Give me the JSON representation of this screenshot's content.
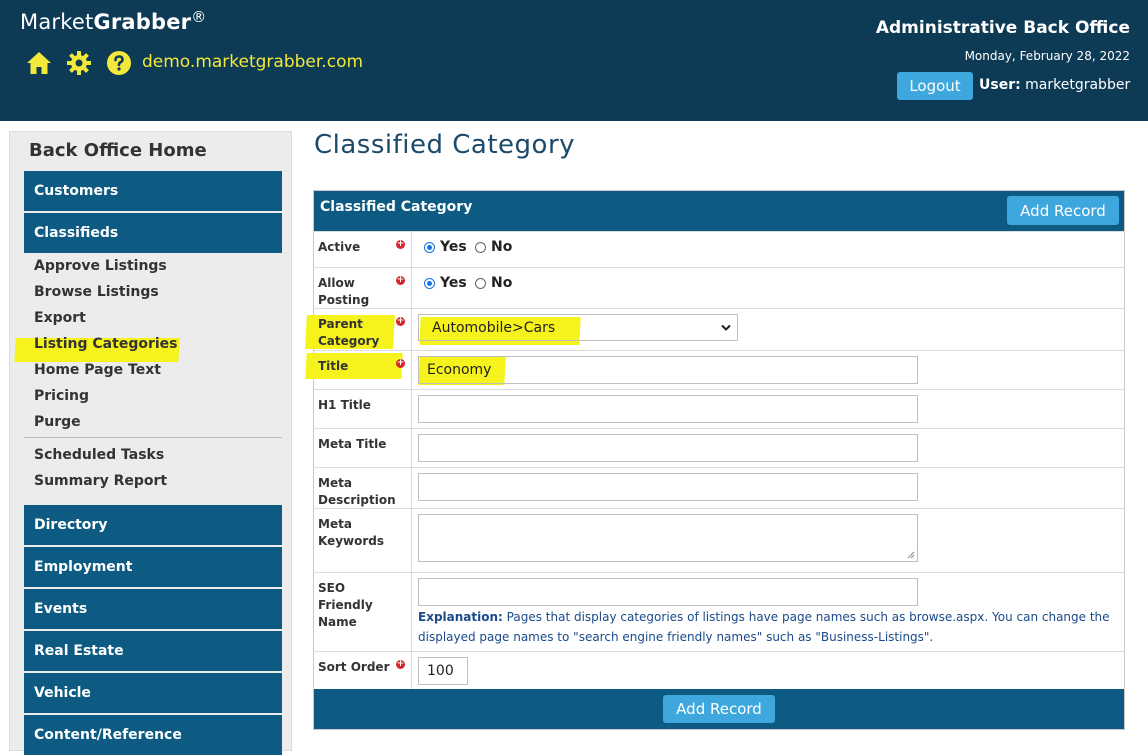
{
  "header": {
    "logo_part1": "Market",
    "logo_part2": "Grabber",
    "logo_reg": "®",
    "site": "demo.marketgrabber.com",
    "title": "Administrative Back Office",
    "date": "Monday, February 28, 2022",
    "logout_label": "Logout",
    "user_label": "User:",
    "user_name": "marketgrabber",
    "icons": [
      "home-icon",
      "gear-icon",
      "help-icon"
    ]
  },
  "sidebar": {
    "home": "Back Office Home",
    "sections": [
      "Customers",
      "Classifieds",
      "Directory",
      "Employment",
      "Events",
      "Real Estate",
      "Vehicle",
      "Content/Reference"
    ],
    "classifieds_links": [
      "Approve Listings",
      "Browse Listings",
      "Export",
      "Listing Categories",
      "Home Page Text",
      "Pricing",
      "Purge"
    ],
    "classifieds_links2": [
      "Scheduled Tasks",
      "Summary Report"
    ]
  },
  "main": {
    "page_title": "Classified Category",
    "form_title": "Classified Category",
    "add_record_label": "Add Record",
    "fields": {
      "active": {
        "label": "Active",
        "yes": "Yes",
        "no": "No",
        "selected": "Yes"
      },
      "allow_posting": {
        "label": "Allow Posting",
        "yes": "Yes",
        "no": "No",
        "selected": "Yes"
      },
      "parent_category": {
        "label": "Parent Category",
        "value": "Automobile>Cars"
      },
      "title": {
        "label": "Title",
        "value": "Economy"
      },
      "h1_title": {
        "label": "H1 Title",
        "value": ""
      },
      "meta_title": {
        "label": "Meta Title",
        "value": ""
      },
      "meta_description": {
        "label": "Meta Description",
        "value": ""
      },
      "meta_keywords": {
        "label": "Meta Keywords",
        "value": ""
      },
      "seo_name": {
        "label": "SEO Friendly Name",
        "value": ""
      },
      "sort_order": {
        "label": "Sort Order",
        "value": "100"
      }
    },
    "explanation_label": "Explanation:",
    "explanation_text": "Pages that display categories of listings have page names such as browse.aspx. You can change the displayed page names to \"search engine friendly names\" such as \"Business-Listings\"."
  },
  "colors": {
    "header_bg": "#0d3a55",
    "section_bg": "#0d5b82",
    "button_bg": "#3ea8de",
    "highlight": "#f6f21b",
    "link_yellow": "#f2e93a"
  }
}
